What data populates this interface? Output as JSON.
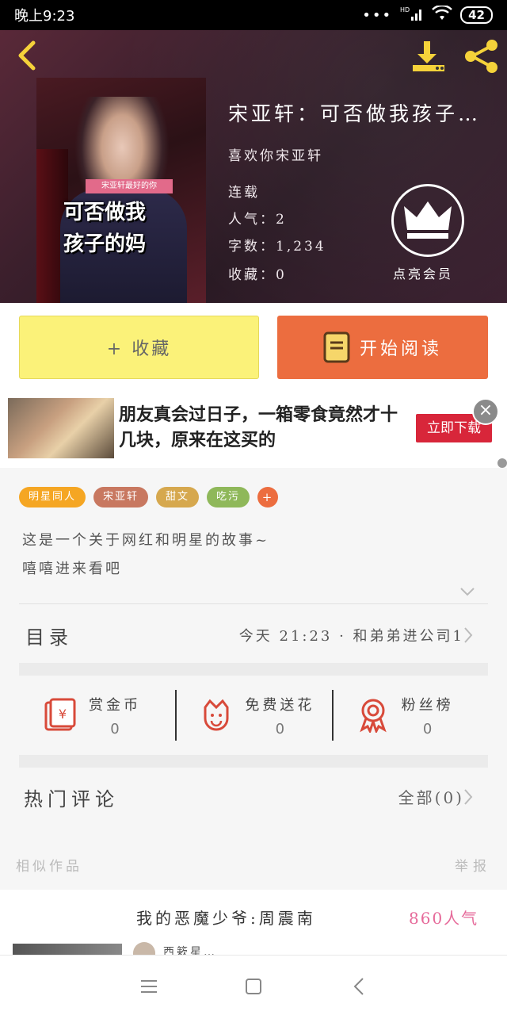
{
  "status_bar": {
    "time": "晚上9:23",
    "dots": "•••",
    "network": "HD",
    "battery": "42"
  },
  "book": {
    "title": "宋亚轩：可否做我孩子…",
    "author": "喜欢你宋亚轩",
    "status": "连载",
    "popularity": "人气：2",
    "word_count": "字数：1,234",
    "favorites": "收藏：0",
    "cover_title_line1": "可否做我",
    "cover_title_line2": "孩子的妈",
    "cover_ribbon": "宋亚轩最好的你"
  },
  "vip": {
    "label": "点亮会员"
  },
  "actions": {
    "favorite": "+ 收藏",
    "read": "开始阅读"
  },
  "ad": {
    "text": "朋友真会过日子，一箱零食竟然才十几块，原来在这买的",
    "cta": "立即下载",
    "close": "×"
  },
  "tags": [
    {
      "label": "明星同人",
      "color": "#f5a623"
    },
    {
      "label": "宋亚轩",
      "color": "#c87860"
    },
    {
      "label": "甜文",
      "color": "#d6a84e"
    },
    {
      "label": "吃污",
      "color": "#8fb85a"
    },
    {
      "label": "+",
      "color": "#ec6d3f"
    }
  ],
  "description": {
    "line1": "这是一个关于网红和明星的故事~",
    "line2": "嘻嘻进来看吧"
  },
  "catalog": {
    "label": "目录",
    "latest": "今天 21:23 · 和弟弟进公司1"
  },
  "stats": [
    {
      "label": "赏金币",
      "value": "0",
      "icon": "red-envelope-icon"
    },
    {
      "label": "免费送花",
      "value": "0",
      "icon": "flower-icon"
    },
    {
      "label": "粉丝榜",
      "value": "0",
      "icon": "medal-icon"
    }
  ],
  "comments": {
    "label": "热门评论",
    "all": "全部(0)"
  },
  "similar": {
    "label": "相似作品",
    "report": "举报"
  },
  "recommendation": {
    "title": "我的恶魔少爷:周震南",
    "popularity": "860人气",
    "author": "西簌星…"
  },
  "colors": {
    "accent": "#ec6d3f",
    "favorite_bg": "#fbf279",
    "pink": "#e66a9a",
    "ad_red": "#d8263a"
  }
}
